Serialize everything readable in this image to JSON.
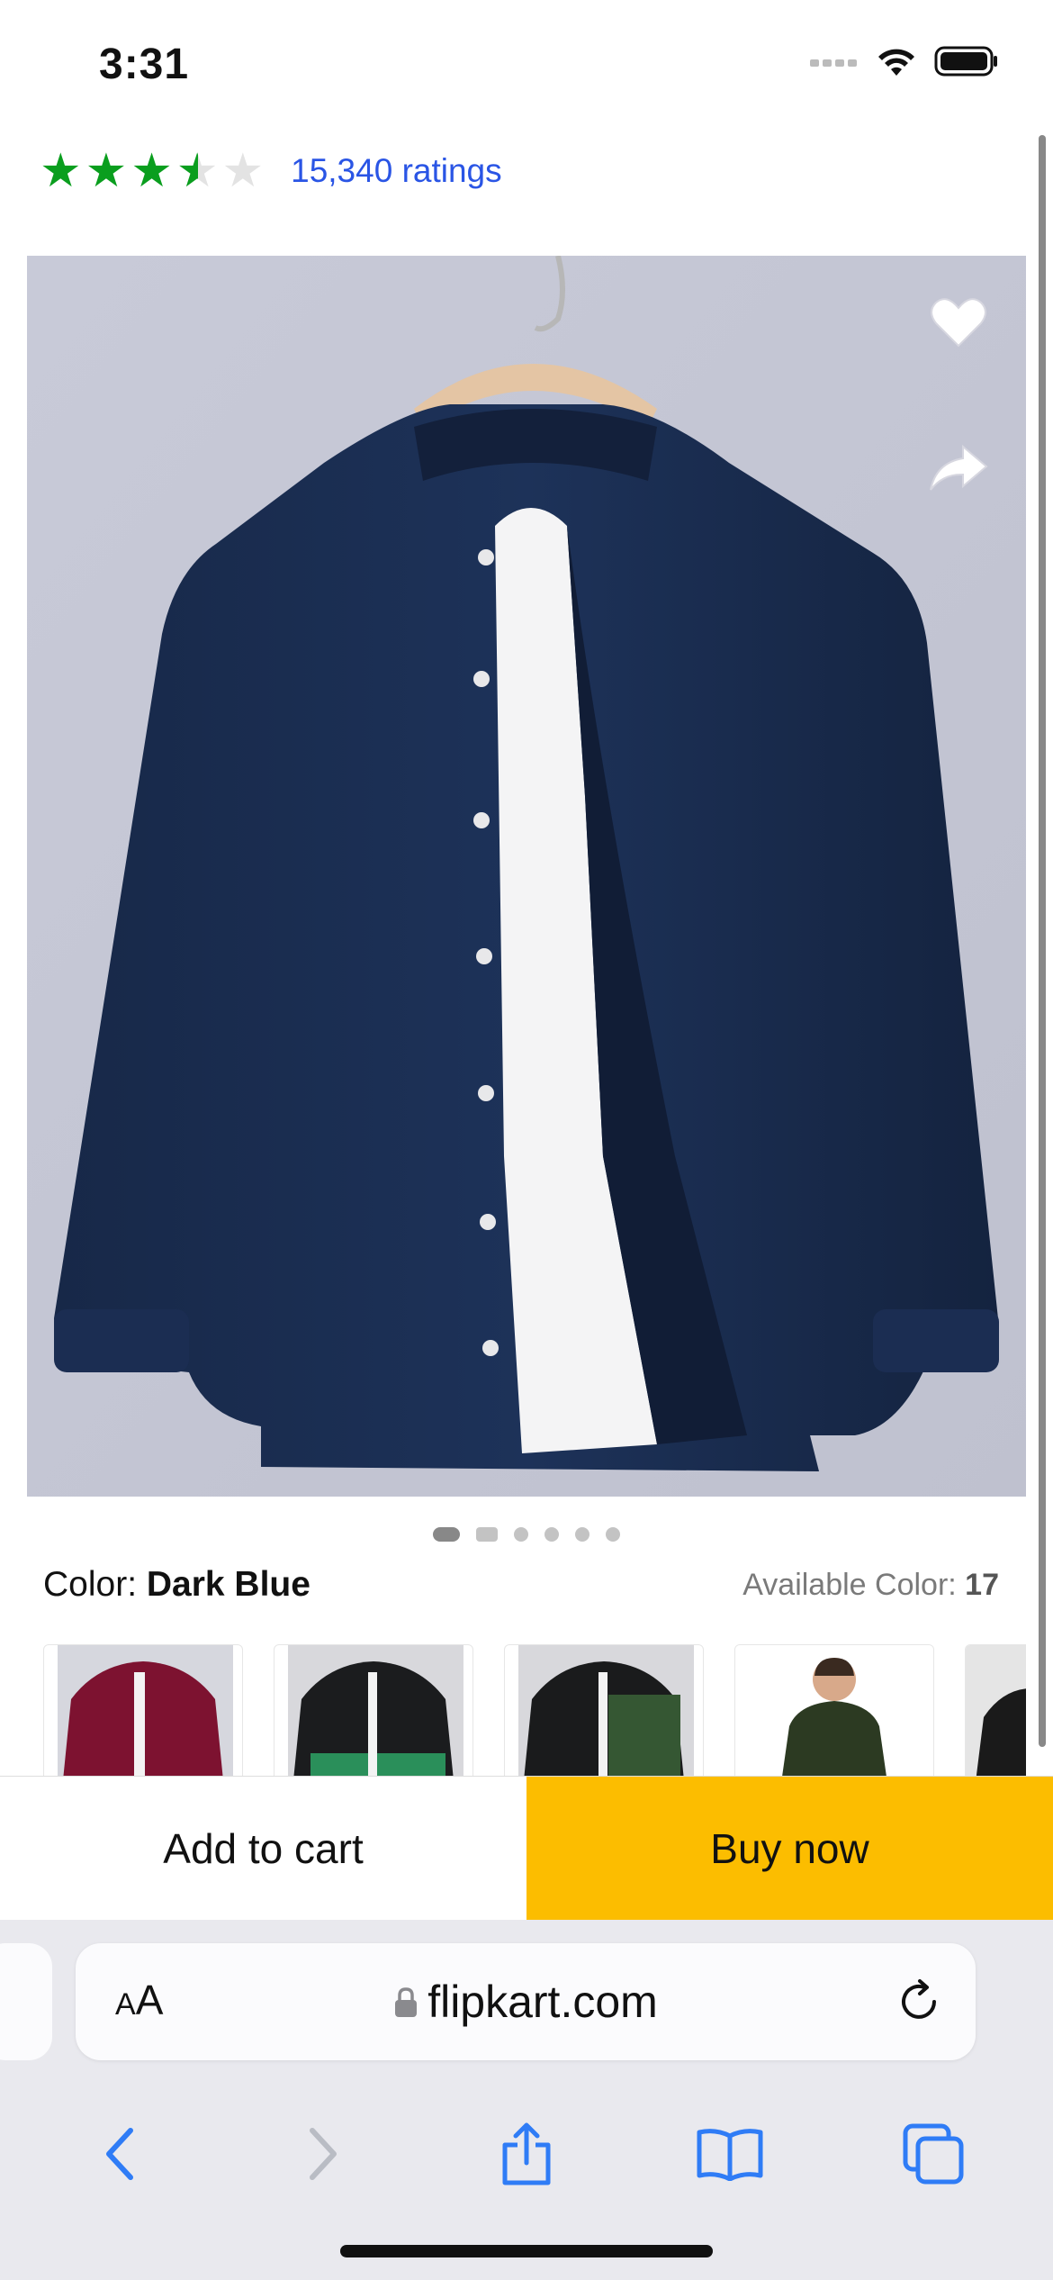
{
  "status_bar": {
    "time": "3:31"
  },
  "product": {
    "rating_value": 3.5,
    "ratings_count_text": "15,340 ratings"
  },
  "gallery": {
    "image_count": 6,
    "active_index": 0
  },
  "color": {
    "label": "Color: ",
    "value": "Dark Blue",
    "available_label": "Available Color: ",
    "available_count": "17"
  },
  "actions": {
    "add_to_cart": "Add to cart",
    "buy_now": "Buy now"
  },
  "browser": {
    "aa_small": "A",
    "aa_large": "A",
    "domain": "flipkart.com"
  },
  "colors": {
    "rating_green": "#0a9e1e",
    "link_blue": "#2a55e5",
    "buy_yellow": "#fcbd00",
    "shirt": "#1b2d52"
  }
}
